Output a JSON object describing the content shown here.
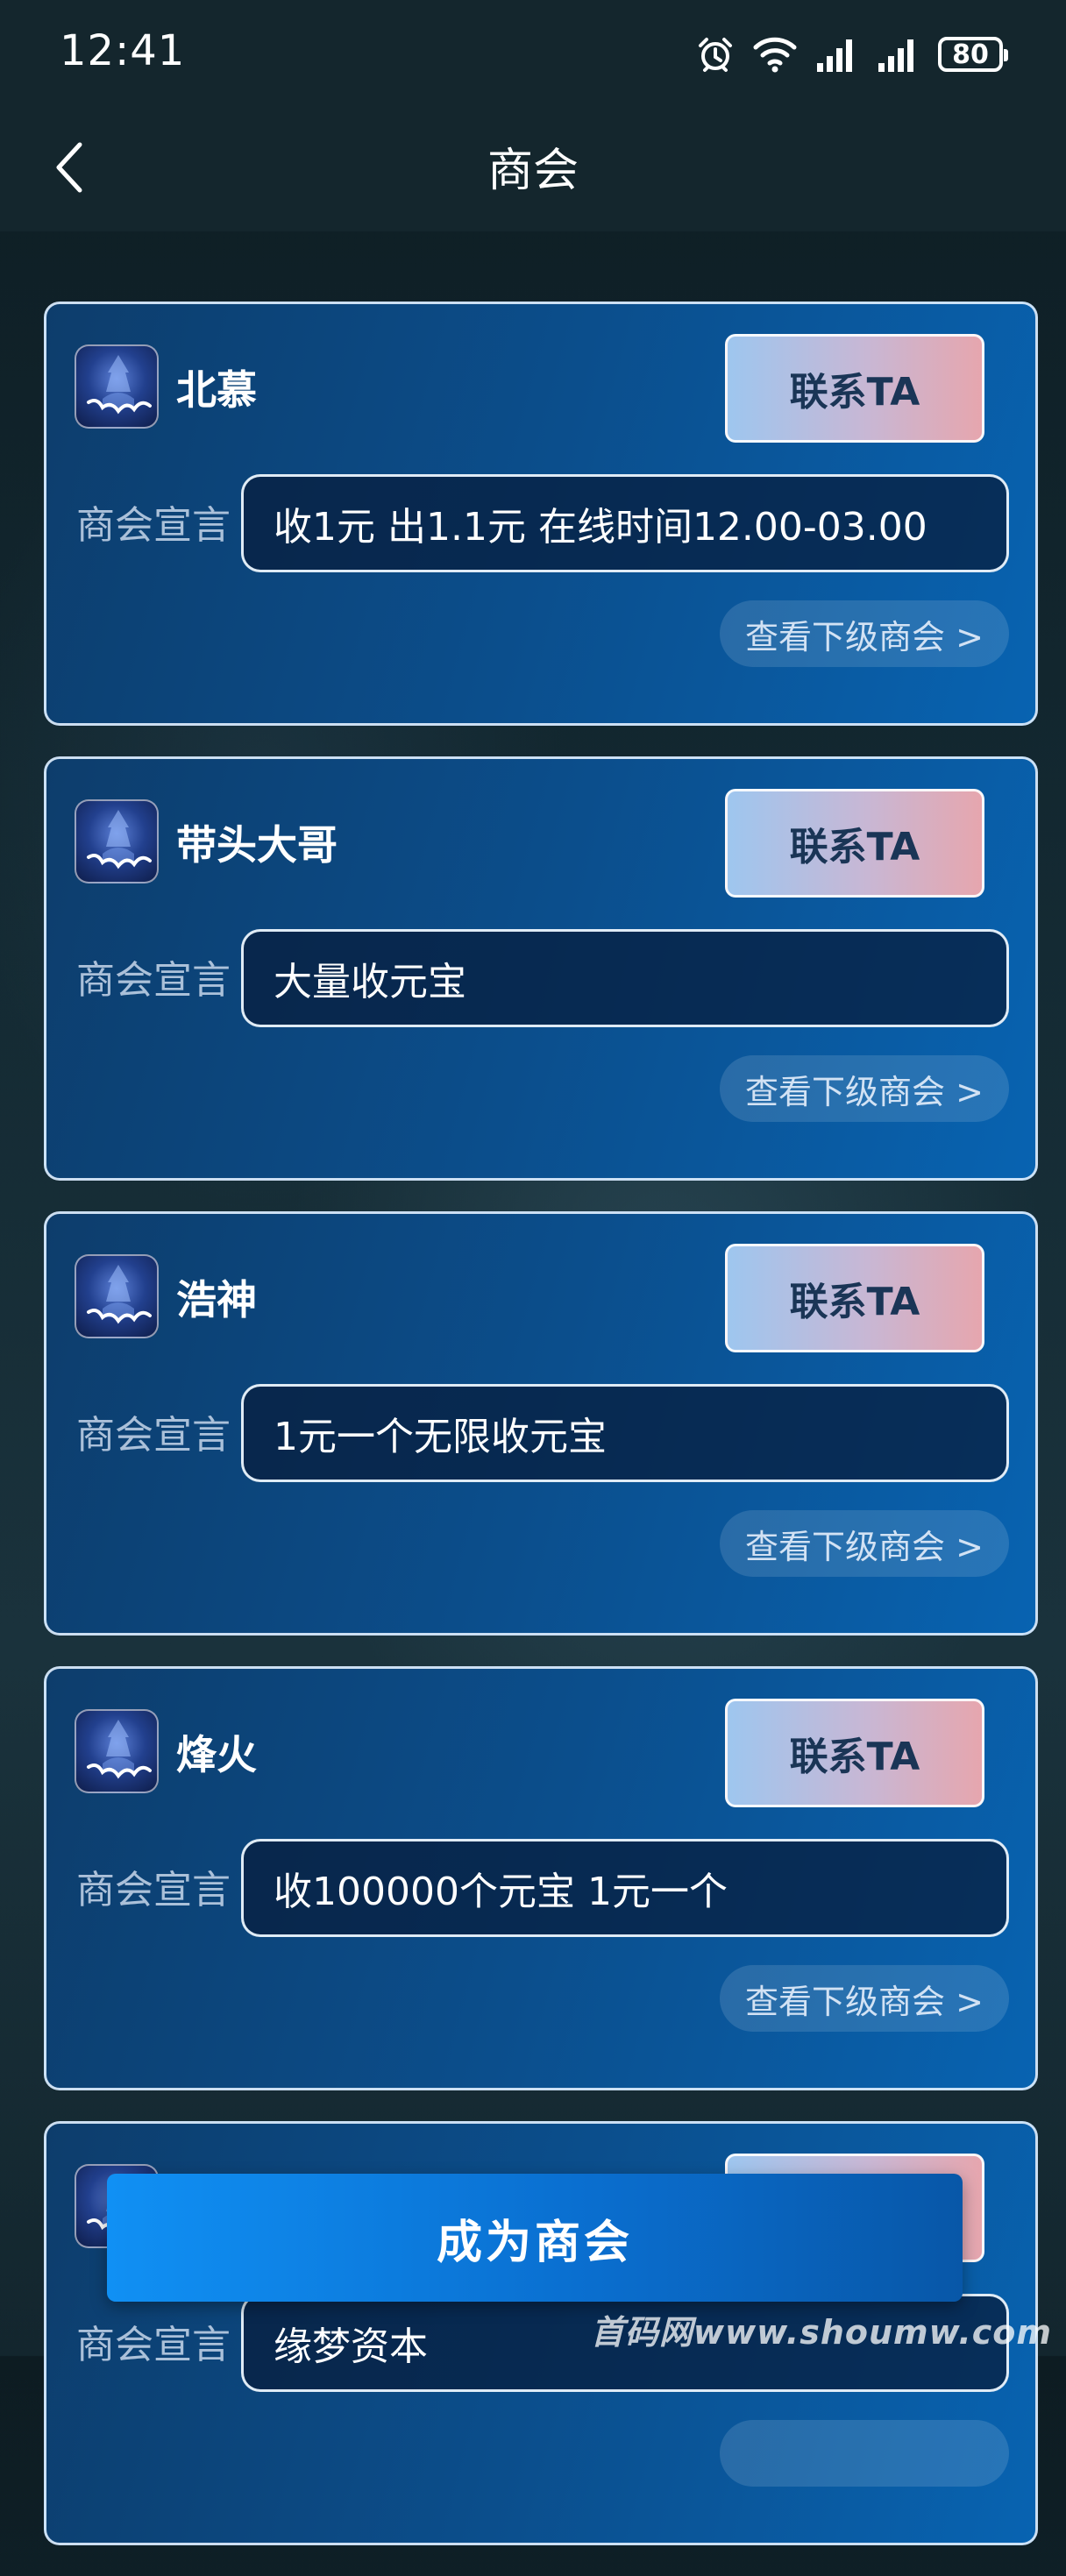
{
  "status_bar": {
    "time": "12:41",
    "battery": "80",
    "icons": [
      "alarm-icon",
      "wifi-icon",
      "signal-icon",
      "signal-icon",
      "battery-icon"
    ]
  },
  "header": {
    "title": "商会",
    "back_icon": "chevron-left-icon"
  },
  "cards": [
    {
      "name": "北慕",
      "contact_label": "联系TA",
      "declaration_label": "商会宣言",
      "declaration": "收1元 出1.1元 在线时间12.00-03.00",
      "sub_label": "查看下级商会 >"
    },
    {
      "name": "带头大哥",
      "contact_label": "联系TA",
      "declaration_label": "商会宣言",
      "declaration": "大量收元宝",
      "sub_label": "查看下级商会 >"
    },
    {
      "name": "浩神",
      "contact_label": "联系TA",
      "declaration_label": "商会宣言",
      "declaration": "1元一个无限收元宝",
      "sub_label": "查看下级商会 >"
    },
    {
      "name": "烽火",
      "contact_label": "联系TA",
      "declaration_label": "商会宣言",
      "declaration": "收100000个元宝 1元一个",
      "sub_label": "查看下级商会 >"
    },
    {
      "name": "",
      "contact_label": "",
      "declaration_label": "商会宣言",
      "declaration": "缘梦资本",
      "sub_label": ""
    }
  ],
  "footer": {
    "become_label": "成为商会"
  },
  "watermark": "首码网www.shoumw.com",
  "colors": {
    "card_gradient_start": "#0d3d6c",
    "card_gradient_end": "#0863b1",
    "button_gradient_start": "#9ec6ef",
    "button_gradient_end": "#e6a6ae",
    "primary_button": "#1090f4"
  }
}
